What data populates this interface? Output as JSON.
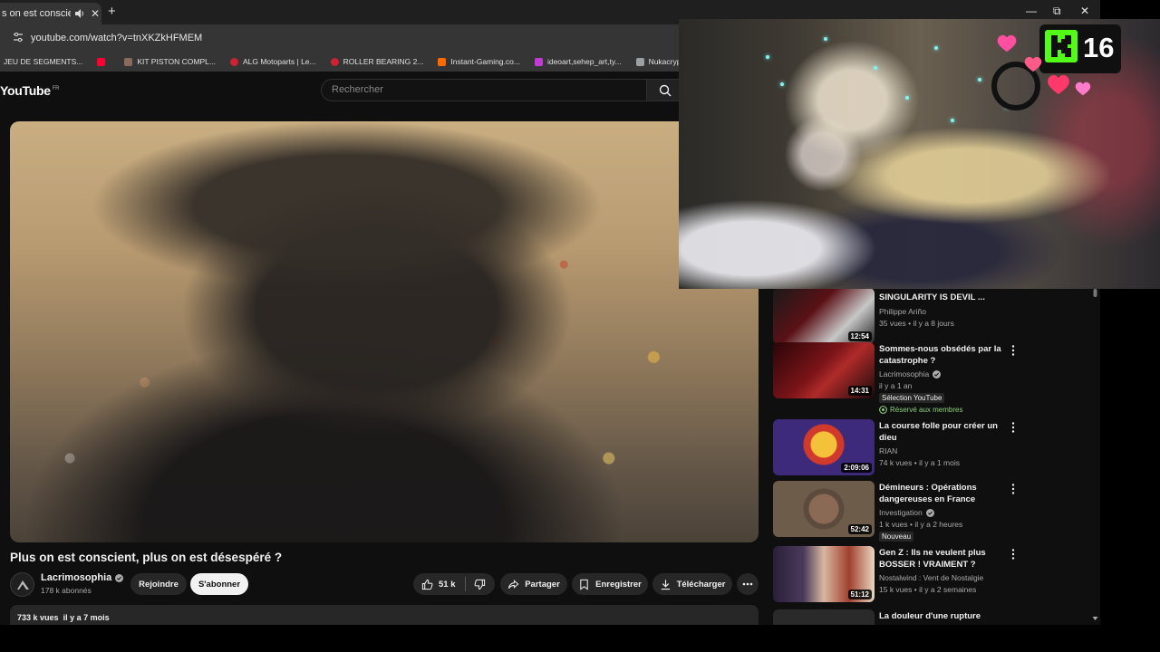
{
  "browser": {
    "tab_title": "s on est conscient, pl",
    "url": "youtube.com/watch?v=tnXKZkHFMEM",
    "bookmarks": [
      {
        "label": "JEU DE SEGMENTS...",
        "color": "#6b6b6b"
      },
      {
        "label": "",
        "color": "#ff0033"
      },
      {
        "label": "KIT PISTON COMPL...",
        "color": "#8a6a5a"
      },
      {
        "label": "ALG Motoparts | Le...",
        "color": "#cc2233"
      },
      {
        "label": "ROLLER BEARING 2...",
        "color": "#cc2233"
      },
      {
        "label": "Instant-Gaming.co...",
        "color": "#ff6a00"
      },
      {
        "label": "ideoart,sehep_art,ty...",
        "color": "#c23bd4"
      },
      {
        "label": "Nukacrypt - All Thin...",
        "color": "#9aa0a6"
      },
      {
        "label": "",
        "color": "#d93025"
      }
    ]
  },
  "youtube": {
    "logo": "YouTube",
    "region": "FR",
    "search_placeholder": "Rechercher",
    "video": {
      "title": "Plus on est conscient, plus on est désespéré ?",
      "channel": "Lacrimosophia",
      "subscribers": "178 k abonnés",
      "join_label": "Rejoindre",
      "subscribe_label": "S'abonner",
      "likes": "51 k",
      "share_label": "Partager",
      "save_label": "Enregistrer",
      "download_label": "Télécharger",
      "views": "733 k vues",
      "published": "il y a 7 mois"
    },
    "recommendations": [
      {
        "title": "SINGULARITY IS DEVIL ...",
        "channel": "Philippe Ariño",
        "meta": "35 vues • il y a 8 jours",
        "duration": "12:54",
        "verified": false,
        "badges": [],
        "thumb": "#5a1116"
      },
      {
        "title": "Sommes-nous obsédés par la catastrophe ?",
        "channel": "Lacrimosophia",
        "meta": "il y a 1 an",
        "duration": "14:31",
        "verified": true,
        "badges": [
          "Sélection YouTube"
        ],
        "members_badge": "Réservé aux membres",
        "thumb": "#7a1418"
      },
      {
        "title": "La course folle pour créer un dieu",
        "channel": "RIAN",
        "meta": "74 k vues • il y a 1 mois",
        "duration": "2:09:06",
        "verified": false,
        "badges": [],
        "thumb": "#3d2a7a"
      },
      {
        "title": "Démineurs : Opérations dangereuses en France",
        "channel": "Investigation",
        "meta": "1 k vues • il y a 2 heures",
        "duration": "52:42",
        "verified": true,
        "badges": [
          "Nouveau"
        ],
        "thumb": "#6d5c4a"
      },
      {
        "title": "Gen Z : Ils ne veulent plus BOSSER ! VRAIMENT ?",
        "channel": "Nostalwind : Vent de Nostalgie",
        "meta": "15 k vues • il y a 2 semaines",
        "duration": "51:12",
        "verified": false,
        "badges": [],
        "thumb": "#a04030"
      },
      {
        "title": "La douleur d'une rupture",
        "channel": "",
        "meta": "",
        "duration": "",
        "verified": false,
        "badges": [],
        "thumb": "#2a2a2a"
      }
    ]
  },
  "overlay": {
    "viewer_count": "16"
  }
}
